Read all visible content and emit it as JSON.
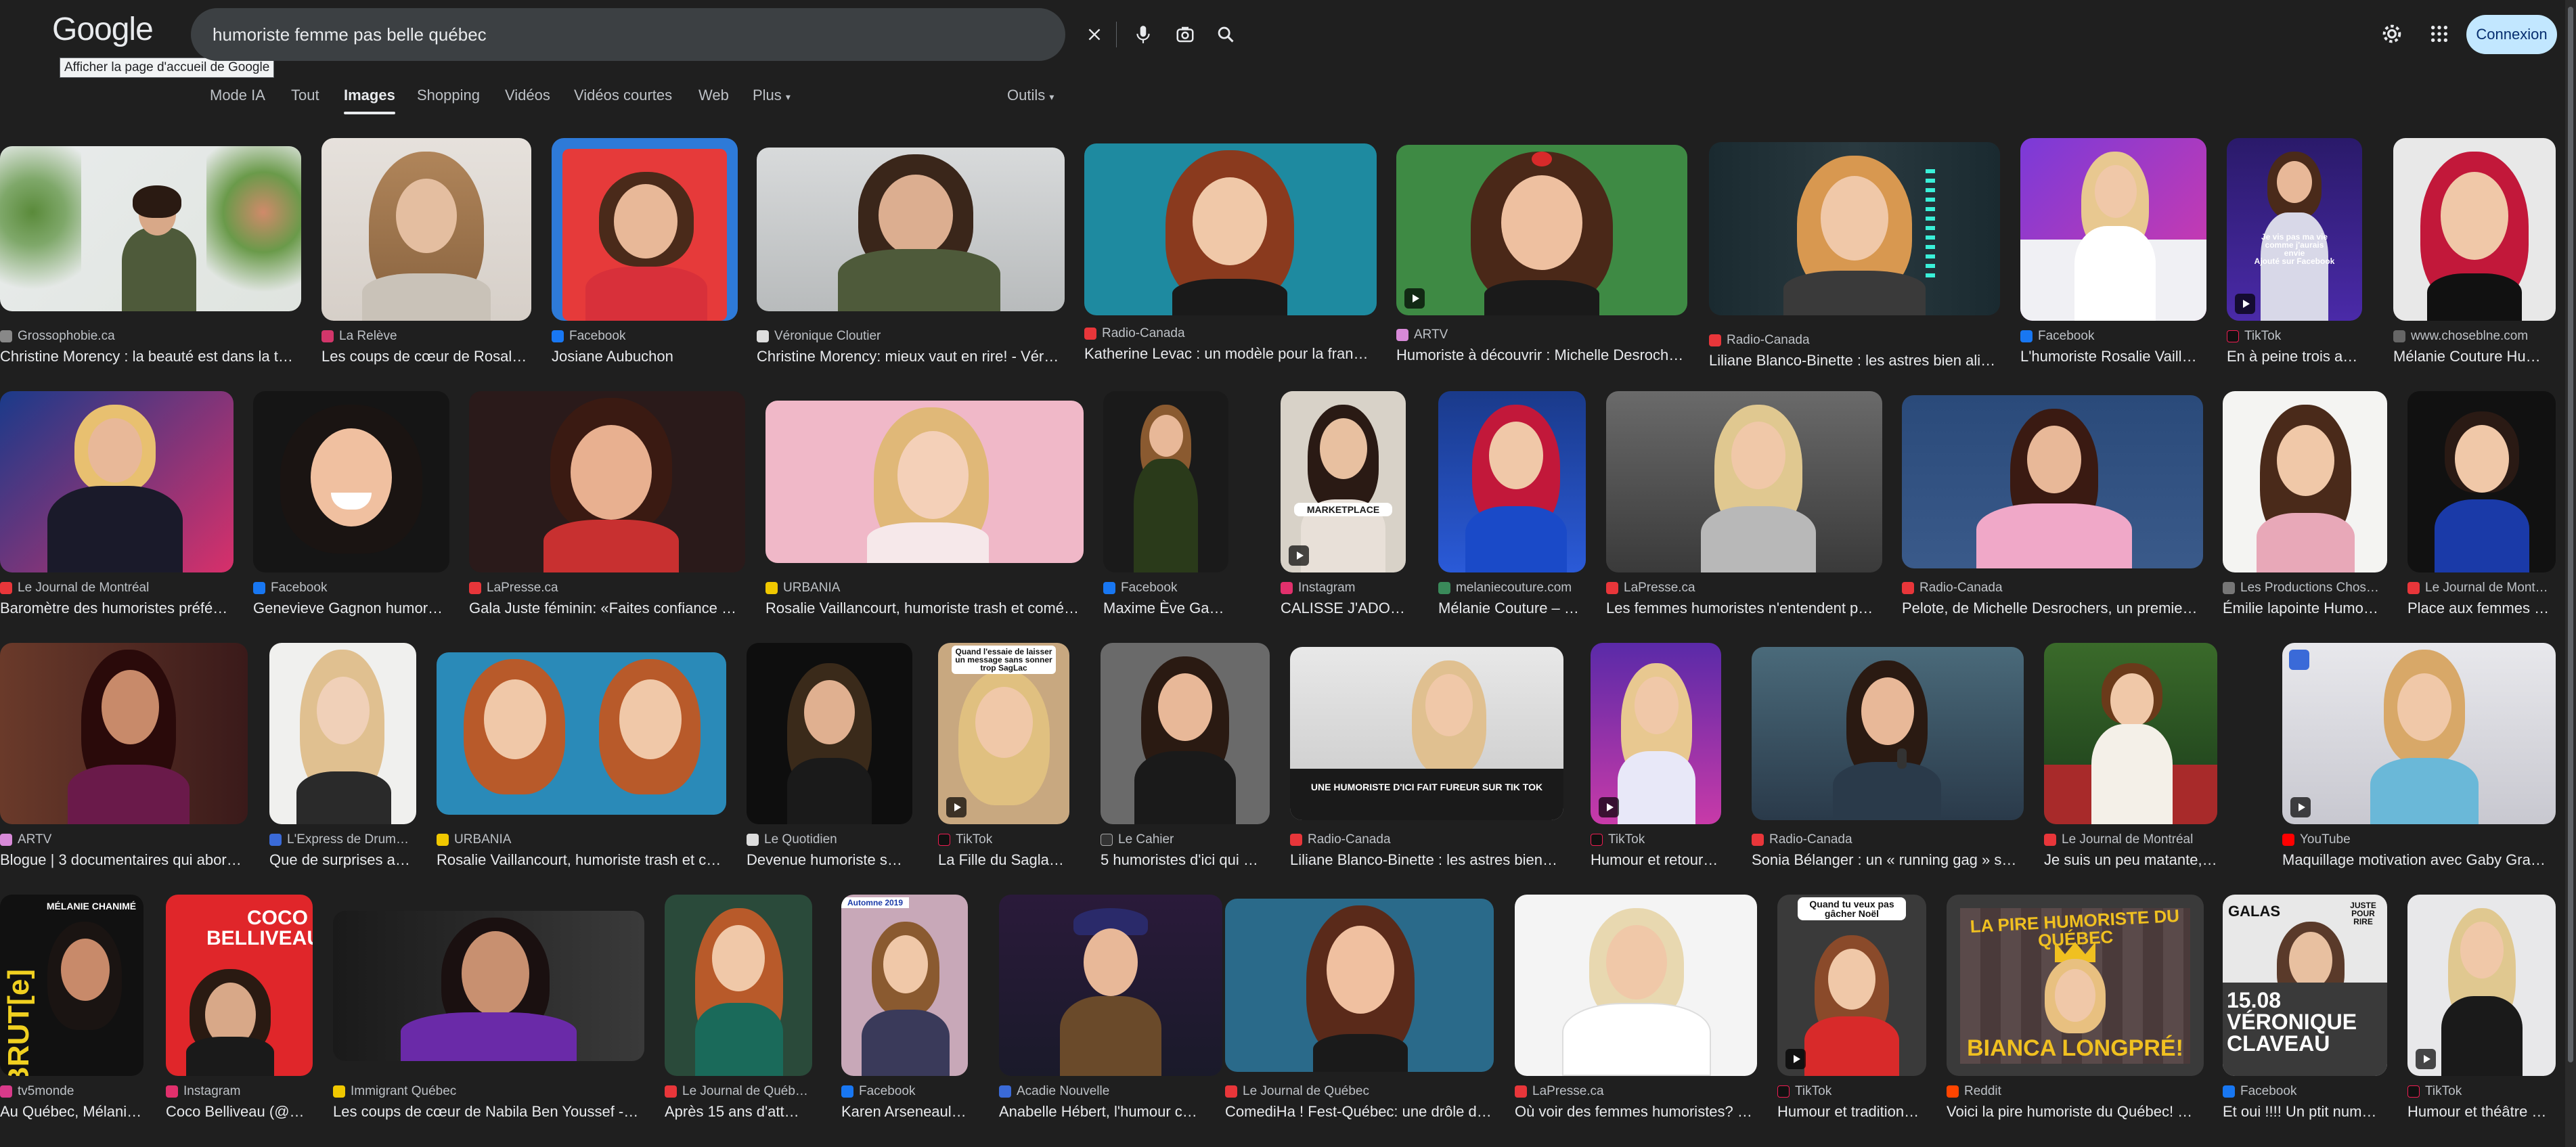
{
  "header": {
    "logo_text": "Google",
    "logo_tooltip": "Afficher la page d'accueil de Google",
    "search_query": "humoriste femme pas belle québec",
    "connexion_label": "Connexion"
  },
  "tabs": [
    {
      "label": "Mode IA"
    },
    {
      "label": "Tout"
    },
    {
      "label": "Images",
      "active": true
    },
    {
      "label": "Shopping"
    },
    {
      "label": "Vidéos"
    },
    {
      "label": "Vidéos courtes"
    },
    {
      "label": "Web"
    },
    {
      "label": "Plus"
    }
  ],
  "tools_label": "Outils",
  "results": [
    {
      "source": "Grossophobie.ca",
      "caption": "Christine Morency : la beauté est dans la t…"
    },
    {
      "source": "La Relève",
      "caption": "Les coups de cœur de Rosal…"
    },
    {
      "source": "Facebook",
      "caption": "Josiane Aubuchon"
    },
    {
      "source": "Véronique Cloutier",
      "caption": "Christine Morency: mieux vaut en rire! - Vér…"
    },
    {
      "source": "Radio-Canada",
      "caption": "Katherine Levac : un modèle pour la fran…"
    },
    {
      "source": "ARTV",
      "caption": "Humoriste à découvrir : Michelle Desroch…"
    },
    {
      "source": "Radio-Canada",
      "caption": "Liliane Blanco-Binette : les astres bien ali…"
    },
    {
      "source": "Facebook",
      "caption": "L'humoriste Rosalie Vaill…"
    },
    {
      "source": "TikTok",
      "caption": "En à peine trois an…"
    },
    {
      "source": "www.choseblne.com",
      "caption": "Mélanie Couture Hu…"
    },
    {
      "source": "Le Journal de Montréal",
      "caption": "Baromètre des humoristes préfé…"
    },
    {
      "source": "Facebook",
      "caption": "Genevieve Gagnon humor…"
    },
    {
      "source": "LaPresse.ca",
      "caption": "Gala Juste féminin: «Faites confiance …"
    },
    {
      "source": "URBANIA",
      "caption": "Rosalie Vaillancourt, humoriste trash et comé…"
    },
    {
      "source": "Facebook",
      "caption": "Maxime Ève Gagn…"
    },
    {
      "source": "Instagram",
      "caption": "CALISSE J'ADOR…"
    },
    {
      "source": "melaniecouture.com",
      "caption": "Mélanie Couture – …"
    },
    {
      "source": "LaPresse.ca",
      "caption": "Les femmes humoristes n'entendent p…"
    },
    {
      "source": "Radio-Canada",
      "caption": "Pelote, de Michelle Desrochers, un premie…"
    },
    {
      "source": "Les Productions Chos…",
      "caption": "Émilie lapointe Humo…"
    },
    {
      "source": "Le Journal de Mont…",
      "caption": "Place aux femmes …"
    },
    {
      "source": "ARTV",
      "caption": "Blogue | 3 documentaires qui abor…"
    },
    {
      "source": "L'Express de Drum…",
      "caption": "Que de surprises a…"
    },
    {
      "source": "URBANIA",
      "caption": "Rosalie Vaillancourt, humoriste trash et c…"
    },
    {
      "source": "Le Quotidien",
      "caption": "Devenue humoriste s…"
    },
    {
      "source": "TikTok",
      "caption": "La Fille du Saglac:…"
    },
    {
      "source": "Le Cahier",
      "caption": "5 humoristes d'ici qui …"
    },
    {
      "source": "Radio-Canada",
      "caption": "Liliane Blanco-Binette : les astres bien…"
    },
    {
      "source": "TikTok",
      "caption": "Humour et retour a…"
    },
    {
      "source": "Radio-Canada",
      "caption": "Sonia Bélanger : un « running gag » s…"
    },
    {
      "source": "Le Journal de Montréal",
      "caption": "Je suis un peu matante, un p…"
    },
    {
      "source": "YouTube",
      "caption": "Maquillage motivation avec Gaby Gra…"
    },
    {
      "source": "tv5monde",
      "caption": "Au Québec, Mélani…"
    },
    {
      "source": "Instagram",
      "caption": "Coco Belliveau (@…"
    },
    {
      "source": "Immigrant Québec",
      "caption": "Les coups de cœur de Nabila Ben Youssef -…"
    },
    {
      "source": "Le Journal de Québ…",
      "caption": "Après 15 ans d'att…"
    },
    {
      "source": "Facebook",
      "caption": "Karen Arseneault …"
    },
    {
      "source": "Acadie Nouvelle",
      "caption": "Anabelle Hébert, l'humour c…"
    },
    {
      "source": "Le Journal de Québec",
      "caption": "ComediHa ! Fest-Québec: une drôle d…"
    },
    {
      "source": "LaPresse.ca",
      "caption": "Où voir des femmes humoristes? …"
    },
    {
      "source": "TikTok",
      "caption": "Humour et tradition…"
    },
    {
      "source": "Reddit",
      "caption": "Voici la pire humoriste du Québec! …"
    },
    {
      "source": "Facebook",
      "caption": "Et oui !!!! Un ptit num…"
    },
    {
      "source": "TikTok",
      "caption": "Humour et théâtre …"
    }
  ],
  "image_text": {
    "r1_9": "Je vis pas ma vie comme j'aurais envie\nAjouté sur Facebook",
    "r2_6": "MARKETPLACE",
    "r3_5": "Quand l'essaie de laisser un message sans sonner trop SagLac",
    "r3_7": "UNE HUMORISTE D'ICI FAIT FUREUR SUR TIK TOK",
    "r4_1a": "MÉLANIE CHANIMÉ",
    "r4_1b": "BRUT[e]",
    "r4_2": "COCO BELLIVEAU",
    "r4_5": "Automne 2019",
    "r4_9": "Quand tu veux pas gâcher Noël",
    "r4_10a": "LA PIRE HUMORISTE DU QUÉBEC",
    "r4_10b": "BIANCA LONGPRÉ!",
    "r4_11a": "GALAS",
    "r4_11b": "JUSTE POUR RIRE",
    "r4_11c": "15.08 VÉRONIQUE CLAVEAU"
  },
  "colors": {
    "background": "#1f1f1f",
    "search_bg": "#3c4043",
    "connexion_bg": "#c2e7ff",
    "text": "#e8eaed",
    "muted": "#bdc1c6"
  }
}
